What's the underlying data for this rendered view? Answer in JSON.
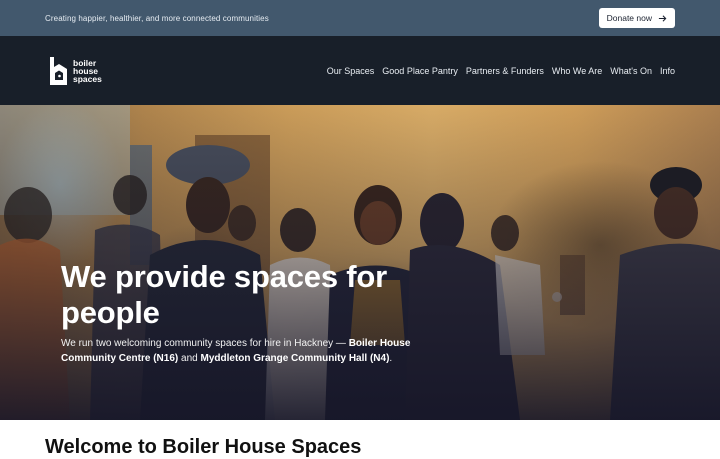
{
  "topbar": {
    "tagline": "Creating happier, healthier, and more connected communities",
    "donate_label": "Donate now"
  },
  "logo": {
    "line1": "boiler",
    "line2": "house",
    "line3": "spaces"
  },
  "nav": {
    "items": [
      "Our Spaces",
      "Good Place Pantry",
      "Partners & Funders",
      "Who We Are",
      "What's On",
      "Info"
    ]
  },
  "hero": {
    "title": "We provide spaces for people",
    "text_intro": "We run two welcoming community spaces for hire in Hackney — ",
    "venue1": "Boiler House Community Centre (N16)",
    "text_and": " and ",
    "venue2": "Myddleton Grange Community Hall (N4)",
    "text_end": "."
  },
  "welcome": {
    "heading": "Welcome to Boiler House Spaces"
  },
  "colors": {
    "topbar": "#42586d",
    "navbar": "#181f29"
  }
}
